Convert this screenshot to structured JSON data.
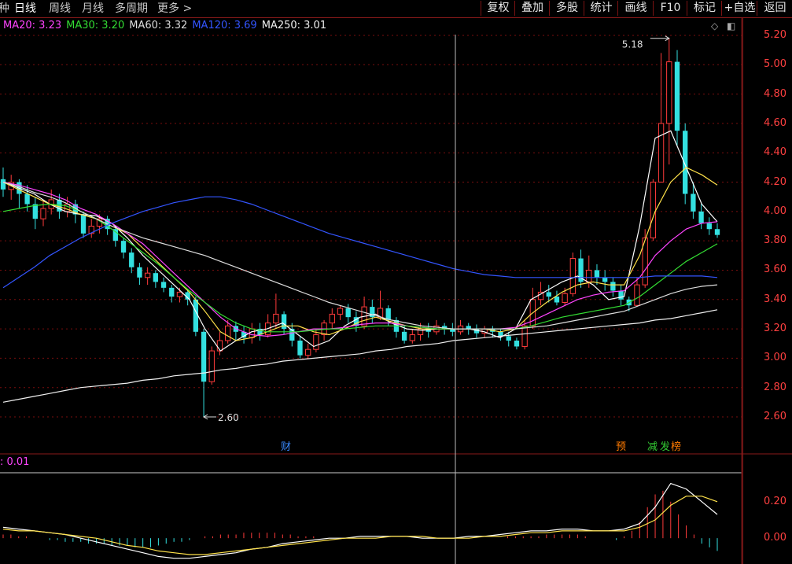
{
  "period_tabs": [
    {
      "label": "种",
      "active": false
    },
    {
      "label": "日线",
      "active": true
    },
    {
      "label": "周线",
      "active": false
    },
    {
      "label": "月线",
      "active": false
    },
    {
      "label": "多周期",
      "active": false
    },
    {
      "label": "更多 >",
      "active": false
    }
  ],
  "toolbar": [
    "复权",
    "叠加",
    "多股",
    "统计",
    "画线",
    "F10",
    "标记",
    "+自选",
    "返回"
  ],
  "ma_legend": [
    {
      "text": "MA20: 3.23",
      "color": "#ff44ff"
    },
    {
      "text": "MA30: 3.20",
      "color": "#33dd33"
    },
    {
      "text": "MA60: 3.32",
      "color": "#dddddd"
    },
    {
      "text": "MA120: 3.69",
      "color": "#3355ff"
    },
    {
      "text": "MA250: 3.01",
      "color": "#f0f0f0"
    }
  ],
  "price_axis": [
    "5.20",
    "5.00",
    "4.80",
    "4.60",
    "4.40",
    "4.20",
    "4.00",
    "3.80",
    "3.60",
    "3.40",
    "3.20",
    "3.00",
    "2.80",
    "2.60"
  ],
  "macd_axis": [
    "0.20",
    "0.00"
  ],
  "macd_legend": ": 0.01",
  "high_label": "5.18",
  "low_label": "2.60",
  "event_markers": [
    {
      "label": "财",
      "color": "#3a8aff"
    },
    {
      "label": "预",
      "color": "#ff7a00"
    },
    {
      "label": "减",
      "color": "#33cc33"
    },
    {
      "label": "发",
      "color": "#33cc33"
    },
    {
      "label": "榜",
      "color": "#ff7a00"
    }
  ],
  "colors": {
    "up": "#ff3b3b",
    "down": "#33e0e0",
    "grid": "#7a0e0e"
  },
  "chart_data": {
    "type": "candlestick",
    "ylim": [
      2.5,
      5.25
    ],
    "candles": [
      [
        4.22,
        4.15,
        4.3,
        4.1
      ],
      [
        4.15,
        4.2,
        4.25,
        4.08
      ],
      [
        4.2,
        4.12,
        4.22,
        4.02
      ],
      [
        4.12,
        4.05,
        4.18,
        4.0
      ],
      [
        4.05,
        3.95,
        4.1,
        3.88
      ],
      [
        3.95,
        4.02,
        4.08,
        3.9
      ],
      [
        4.02,
        4.08,
        4.15,
        3.98
      ],
      [
        4.08,
        4.0,
        4.12,
        3.95
      ],
      [
        4.0,
        4.05,
        4.1,
        3.96
      ],
      [
        4.05,
        3.98,
        4.08,
        3.92
      ],
      [
        3.98,
        3.85,
        4.0,
        3.82
      ],
      [
        3.85,
        3.9,
        3.95,
        3.82
      ],
      [
        3.9,
        3.95,
        3.98,
        3.85
      ],
      [
        3.95,
        3.88,
        3.97,
        3.84
      ],
      [
        3.88,
        3.8,
        3.9,
        3.76
      ],
      [
        3.8,
        3.72,
        3.82,
        3.68
      ],
      [
        3.72,
        3.62,
        3.75,
        3.58
      ],
      [
        3.62,
        3.55,
        3.65,
        3.5
      ],
      [
        3.55,
        3.58,
        3.62,
        3.5
      ],
      [
        3.58,
        3.52,
        3.6,
        3.48
      ],
      [
        3.52,
        3.48,
        3.55,
        3.45
      ],
      [
        3.48,
        3.42,
        3.5,
        3.38
      ],
      [
        3.42,
        3.45,
        3.48,
        3.38
      ],
      [
        3.45,
        3.4,
        3.47,
        3.36
      ],
      [
        3.4,
        3.18,
        3.42,
        3.15
      ],
      [
        3.18,
        2.84,
        3.2,
        2.6
      ],
      [
        2.84,
        3.05,
        3.08,
        2.82
      ],
      [
        3.05,
        3.12,
        3.18,
        3.02
      ],
      [
        3.12,
        3.22,
        3.26,
        3.1
      ],
      [
        3.22,
        3.18,
        3.25,
        3.12
      ],
      [
        3.18,
        3.14,
        3.22,
        3.1
      ],
      [
        3.14,
        3.2,
        3.24,
        3.1
      ],
      [
        3.2,
        3.16,
        3.24,
        3.12
      ],
      [
        3.16,
        3.24,
        3.3,
        3.14
      ],
      [
        3.24,
        3.3,
        3.44,
        3.2
      ],
      [
        3.3,
        3.2,
        3.32,
        3.16
      ],
      [
        3.2,
        3.12,
        3.24,
        3.08
      ],
      [
        3.12,
        3.02,
        3.15,
        3.0
      ],
      [
        3.02,
        3.06,
        3.1,
        3.0
      ],
      [
        3.06,
        3.16,
        3.2,
        3.04
      ],
      [
        3.16,
        3.24,
        3.26,
        3.12
      ],
      [
        3.24,
        3.3,
        3.34,
        3.2
      ],
      [
        3.3,
        3.34,
        3.36,
        3.26
      ],
      [
        3.34,
        3.28,
        3.37,
        3.24
      ],
      [
        3.28,
        3.22,
        3.32,
        3.18
      ],
      [
        3.22,
        3.35,
        3.42,
        3.2
      ],
      [
        3.35,
        3.28,
        3.4,
        3.24
      ],
      [
        3.28,
        3.34,
        3.46,
        3.26
      ],
      [
        3.34,
        3.26,
        3.36,
        3.22
      ],
      [
        3.26,
        3.18,
        3.28,
        3.14
      ],
      [
        3.18,
        3.12,
        3.22,
        3.1
      ],
      [
        3.12,
        3.16,
        3.2,
        3.1
      ],
      [
        3.16,
        3.2,
        3.24,
        3.12
      ],
      [
        3.2,
        3.18,
        3.24,
        3.14
      ],
      [
        3.18,
        3.22,
        3.26,
        3.16
      ],
      [
        3.22,
        3.2,
        3.24,
        3.16
      ],
      [
        3.2,
        3.18,
        3.24,
        3.15
      ],
      [
        3.18,
        3.22,
        3.26,
        3.16
      ],
      [
        3.22,
        3.2,
        3.24,
        3.16
      ],
      [
        3.2,
        3.17,
        3.23,
        3.14
      ],
      [
        3.17,
        3.2,
        3.22,
        3.14
      ],
      [
        3.2,
        3.18,
        3.22,
        3.14
      ],
      [
        3.18,
        3.15,
        3.2,
        3.12
      ],
      [
        3.15,
        3.12,
        3.18,
        3.08
      ],
      [
        3.12,
        3.08,
        3.14,
        3.06
      ],
      [
        3.08,
        3.22,
        3.26,
        3.06
      ],
      [
        3.22,
        3.4,
        3.48,
        3.2
      ],
      [
        3.4,
        3.45,
        3.52,
        3.36
      ],
      [
        3.45,
        3.42,
        3.5,
        3.38
      ],
      [
        3.42,
        3.38,
        3.46,
        3.36
      ],
      [
        3.38,
        3.44,
        3.48,
        3.36
      ],
      [
        3.44,
        3.68,
        3.72,
        3.42
      ],
      [
        3.68,
        3.52,
        3.74,
        3.48
      ],
      [
        3.52,
        3.6,
        3.7,
        3.48
      ],
      [
        3.6,
        3.55,
        3.64,
        3.5
      ],
      [
        3.55,
        3.52,
        3.6,
        3.46
      ],
      [
        3.52,
        3.46,
        3.55,
        3.42
      ],
      [
        3.46,
        3.4,
        3.5,
        3.36
      ],
      [
        3.4,
        3.36,
        3.42,
        3.32
      ],
      [
        3.36,
        3.5,
        3.55,
        3.35
      ],
      [
        3.5,
        3.82,
        3.88,
        3.48
      ],
      [
        3.82,
        4.2,
        4.22,
        3.8
      ],
      [
        4.2,
        4.6,
        5.08,
        4.4
      ],
      [
        4.6,
        5.02,
        5.18,
        4.32
      ],
      [
        5.02,
        4.55,
        5.1,
        4.45
      ],
      [
        4.55,
        4.12,
        4.6,
        4.05
      ],
      [
        4.12,
        4.0,
        4.2,
        3.95
      ],
      [
        4.0,
        3.92,
        4.05,
        3.88
      ],
      [
        3.92,
        3.88,
        3.96,
        3.84
      ],
      [
        3.88,
        3.84,
        3.92,
        3.82
      ]
    ],
    "ma_lines": [
      {
        "name": "MA5",
        "color": "#ffffff",
        "points": [
          4.2,
          4.16,
          4.12,
          4.05,
          4.0,
          3.98,
          3.97,
          3.92,
          3.82,
          3.7,
          3.6,
          3.5,
          3.4,
          3.2,
          3.05,
          3.12,
          3.18,
          3.2,
          3.24,
          3.16,
          3.08,
          3.12,
          3.22,
          3.28,
          3.3,
          3.24,
          3.2,
          3.19,
          3.2,
          3.2,
          3.2,
          3.18,
          3.14,
          3.2,
          3.4,
          3.46,
          3.52,
          3.56,
          3.5,
          3.4,
          3.42,
          3.9,
          4.5,
          4.55,
          4.3,
          4.05,
          3.93
        ]
      },
      {
        "name": "MA10",
        "color": "#ffe24a",
        "points": [
          4.2,
          4.15,
          4.1,
          4.05,
          4.02,
          3.98,
          3.95,
          3.9,
          3.85,
          3.75,
          3.65,
          3.55,
          3.45,
          3.32,
          3.18,
          3.12,
          3.14,
          3.18,
          3.22,
          3.22,
          3.18,
          3.16,
          3.2,
          3.25,
          3.28,
          3.25,
          3.22,
          3.2,
          3.2,
          3.2,
          3.2,
          3.2,
          3.18,
          3.2,
          3.3,
          3.38,
          3.45,
          3.5,
          3.52,
          3.5,
          3.5,
          3.7,
          4.0,
          4.2,
          4.3,
          4.25,
          4.18
        ]
      },
      {
        "name": "MA20",
        "color": "#ff44ff",
        "points": [
          4.2,
          4.18,
          4.15,
          4.12,
          4.08,
          4.02,
          3.98,
          3.92,
          3.85,
          3.78,
          3.68,
          3.58,
          3.48,
          3.38,
          3.28,
          3.2,
          3.16,
          3.15,
          3.16,
          3.18,
          3.2,
          3.2,
          3.21,
          3.23,
          3.24,
          3.24,
          3.22,
          3.21,
          3.2,
          3.2,
          3.2,
          3.2,
          3.2,
          3.21,
          3.25,
          3.3,
          3.35,
          3.4,
          3.43,
          3.45,
          3.46,
          3.55,
          3.7,
          3.8,
          3.88,
          3.92,
          3.93
        ]
      },
      {
        "name": "MA30",
        "color": "#33dd33",
        "points": [
          4.0,
          4.02,
          4.04,
          4.05,
          4.04,
          4.0,
          3.95,
          3.88,
          3.8,
          3.72,
          3.64,
          3.55,
          3.46,
          3.38,
          3.3,
          3.24,
          3.2,
          3.18,
          3.18,
          3.18,
          3.19,
          3.2,
          3.2,
          3.21,
          3.22,
          3.22,
          3.22,
          3.21,
          3.2,
          3.2,
          3.2,
          3.2,
          3.2,
          3.2,
          3.22,
          3.25,
          3.28,
          3.3,
          3.32,
          3.34,
          3.36,
          3.42,
          3.5,
          3.58,
          3.66,
          3.72,
          3.78
        ]
      },
      {
        "name": "MA60",
        "color": "#dddddd",
        "points": [
          4.2,
          4.17,
          4.13,
          4.1,
          4.06,
          4.0,
          3.95,
          3.9,
          3.86,
          3.82,
          3.79,
          3.76,
          3.73,
          3.7,
          3.66,
          3.62,
          3.58,
          3.54,
          3.5,
          3.46,
          3.42,
          3.38,
          3.35,
          3.32,
          3.29,
          3.26,
          3.24,
          3.22,
          3.21,
          3.2,
          3.2,
          3.2,
          3.2,
          3.2,
          3.21,
          3.22,
          3.24,
          3.26,
          3.28,
          3.3,
          3.32,
          3.36,
          3.4,
          3.44,
          3.47,
          3.49,
          3.5
        ]
      },
      {
        "name": "MA120",
        "color": "#3355ff",
        "points": [
          3.48,
          3.55,
          3.62,
          3.7,
          3.76,
          3.82,
          3.87,
          3.92,
          3.96,
          4.0,
          4.03,
          4.06,
          4.08,
          4.1,
          4.1,
          4.08,
          4.05,
          4.01,
          3.97,
          3.93,
          3.89,
          3.85,
          3.82,
          3.79,
          3.76,
          3.73,
          3.7,
          3.67,
          3.64,
          3.61,
          3.59,
          3.57,
          3.56,
          3.55,
          3.55,
          3.55,
          3.55,
          3.55,
          3.55,
          3.55,
          3.55,
          3.55,
          3.56,
          3.56,
          3.56,
          3.56,
          3.55
        ]
      },
      {
        "name": "MA250",
        "color": "#f0f0f0",
        "points": [
          2.7,
          2.72,
          2.74,
          2.76,
          2.78,
          2.8,
          2.81,
          2.82,
          2.83,
          2.85,
          2.86,
          2.88,
          2.89,
          2.9,
          2.92,
          2.93,
          2.95,
          2.96,
          2.98,
          2.99,
          3.0,
          3.01,
          3.02,
          3.03,
          3.05,
          3.06,
          3.08,
          3.09,
          3.1,
          3.12,
          3.13,
          3.14,
          3.15,
          3.16,
          3.17,
          3.18,
          3.19,
          3.2,
          3.21,
          3.22,
          3.23,
          3.24,
          3.26,
          3.27,
          3.29,
          3.31,
          3.33
        ]
      }
    ],
    "macd": {
      "ylim": [
        -0.12,
        0.35
      ],
      "hist": [
        0.02,
        0.02,
        0.01,
        0.01,
        0.0,
        0.0,
        -0.01,
        -0.01,
        -0.02,
        -0.02,
        -0.02,
        -0.03,
        -0.03,
        -0.03,
        -0.04,
        -0.04,
        -0.04,
        -0.05,
        -0.05,
        -0.05,
        -0.04,
        -0.03,
        -0.02,
        -0.02,
        -0.01,
        0.0,
        0.01,
        0.01,
        0.02,
        0.02,
        0.02,
        0.03,
        0.03,
        0.03,
        0.03,
        0.03,
        0.02,
        0.02,
        0.01,
        0.01,
        0.01,
        0.0,
        0.0,
        0.0,
        0.0,
        0.0,
        0.0,
        0.0,
        0.0,
        0.0,
        0.0,
        0.0,
        0.0,
        0.0,
        0.0,
        0.0,
        0.0,
        0.0,
        0.0,
        0.0,
        0.0,
        0.0,
        0.0,
        0.0,
        0.0,
        0.01,
        0.01,
        0.01,
        0.01,
        0.01,
        0.02,
        0.02,
        0.02,
        0.02,
        0.02,
        0.01,
        0.0,
        0.0,
        0.0,
        -0.01,
        0.01,
        0.04,
        0.09,
        0.17,
        0.24,
        0.26,
        0.2,
        0.13,
        0.07,
        0.02,
        -0.03,
        -0.05,
        -0.07
      ],
      "dif": [
        0.06,
        0.05,
        0.04,
        0.03,
        0.02,
        0.0,
        -0.02,
        -0.04,
        -0.06,
        -0.08,
        -0.1,
        -0.11,
        -0.11,
        -0.1,
        -0.09,
        -0.08,
        -0.06,
        -0.05,
        -0.03,
        -0.02,
        -0.01,
        0.0,
        0.0,
        0.01,
        0.01,
        0.01,
        0.01,
        0.0,
        0.0,
        0.0,
        0.01,
        0.01,
        0.02,
        0.03,
        0.04,
        0.04,
        0.05,
        0.05,
        0.04,
        0.04,
        0.05,
        0.08,
        0.17,
        0.3,
        0.27,
        0.2,
        0.13
      ],
      "dea": [
        0.05,
        0.04,
        0.04,
        0.03,
        0.02,
        0.01,
        0.0,
        -0.02,
        -0.04,
        -0.05,
        -0.07,
        -0.08,
        -0.09,
        -0.09,
        -0.08,
        -0.07,
        -0.06,
        -0.05,
        -0.04,
        -0.03,
        -0.02,
        -0.01,
        0.0,
        0.0,
        0.0,
        0.01,
        0.01,
        0.01,
        0.0,
        0.0,
        0.0,
        0.01,
        0.01,
        0.02,
        0.03,
        0.03,
        0.04,
        0.04,
        0.04,
        0.04,
        0.04,
        0.06,
        0.1,
        0.18,
        0.23,
        0.23,
        0.2
      ]
    }
  }
}
